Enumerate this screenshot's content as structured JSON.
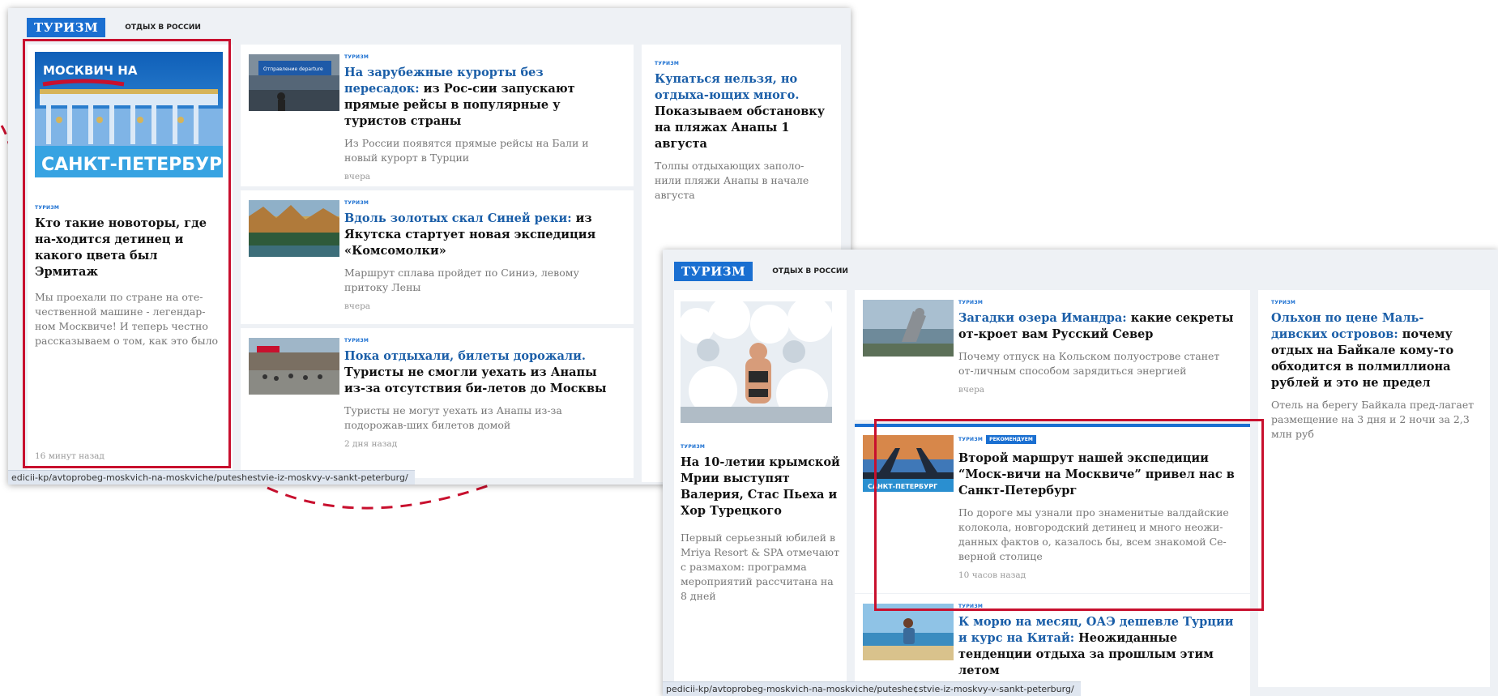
{
  "shot_a": {
    "section_tag": "ТУРИЗМ",
    "sub_tag": "ОТДЫХ В РОССИИ",
    "featured": {
      "banner_top": "МОСКВИЧ НА",
      "banner_bottom": "САНКТ-ПЕТЕРБУРГ",
      "kicker": "ТУРИЗМ",
      "title": "Кто такие новоторы, где на-ходится детинец и какого цвета был Эрмитаж",
      "lead": "Мы проехали по стране на оте-чественной машине - легендар-ном Москвиче! И теперь честно рассказываем о том, как это было",
      "time": "16 минут назад"
    },
    "rows": [
      {
        "kicker": "ТУРИЗМ",
        "title_highlight": "На зарубежные курорты без пересадок:",
        "title_rest": " из Рос-сии запускают прямые рейсы в популярные у туристов страны",
        "lead": "Из России появятся прямые рейсы на Бали и новый курорт в Турции",
        "time": "вчера",
        "sign_text": "Отправление departure"
      },
      {
        "kicker": "ТУРИЗМ",
        "title_highlight": "Вдоль золотых скал Синей реки:",
        "title_rest": " из Якутска стартует новая экспедиция «Комсомолки»",
        "lead": "Маршрут сплава пройдет по Синиэ, левому притоку Лены",
        "time": "вчера"
      },
      {
        "kicker": "ТУРИЗМ",
        "title_highlight": "Пока отдыхали, билеты дорожали.",
        "title_rest": " Туристы не смогли уехать из Анапы из-за отсутствия би-летов до Москвы",
        "lead": "Туристы не могут уехать из Анапы из-за подорожав-ших билетов домой",
        "time": "2 дня назад"
      }
    ],
    "side": {
      "kicker": "ТУРИЗМ",
      "title_highlight": "Купаться нельзя, но отдыха-ющих много.",
      "title_rest": " Показываем обстановку на пляжах Анапы 1 августа",
      "lead": "Толпы отдыхающих заполо-нили пляжи Анапы в начале августа"
    },
    "url": "edicii-kp/avtoprobeg-moskvich-na-moskviche/puteshestvie-iz-moskvy-v-sankt-peterburg/"
  },
  "shot_b": {
    "section_tag": "ТУРИЗМ",
    "sub_tag": "ОТДЫХ В РОССИИ",
    "featured": {
      "kicker": "ТУРИЗМ",
      "title": "На 10-летии крымской Мрии выступят Валерия, Стас Пьеха и Хор Турецкого",
      "lead": "Первый серьезный юбилей в Mriya Resort & SPA отмечают с размахом: программа мероприятий рассчитана на 8 дней"
    },
    "rows": [
      {
        "kicker": "ТУРИЗМ",
        "title_highlight": "Загадки озера Имандра:",
        "title_rest": " какие секреты от-кроет вам Русский Север",
        "lead": "Почему отпуск на Кольском полуострове станет от-личным способом зарядиться энергией",
        "time": "вчера"
      },
      {
        "kicker": "ТУРИЗМ",
        "badge": "РЕКОМЕНДУЕМ",
        "title": "Второй маршрут нашей экспедиции “Моск-вичи на Москвиче” привел нас в Санкт-Петербург",
        "lead": "По дороге мы узнали про знаменитые валдайские колокола, новгородский детинец и много неожи-данных фактов о, казалось бы, всем знакомой Се-верной столице",
        "time": "10 часов назад",
        "thumb_text": "САНКТ-ПЕТЕРБУРГ"
      },
      {
        "kicker": "ТУРИЗМ",
        "title_highlight": "К морю на месяц, ОАЭ дешевле Турции и курс на Китай:",
        "title_rest": " Неожиданные тенденции отдыха за прошлым этим летом"
      }
    ],
    "side": {
      "kicker": "ТУРИЗМ",
      "title_highlight": "Ольхон по цене Маль-дивских островов:",
      "title_rest": " почему отдых на Байкале кому-то обходится в полмиллиона рублей и это не предел",
      "lead": "Отель на берегу Байкала пред-лагает размещение на 3 дня и 2 ночи за 2,3 млн руб"
    },
    "url": "pedicii-kp/avtoprobeg-moskvich-na-moskviche/puteshe¢stvie-iz-moskvy-v-sankt-peterburg/"
  },
  "colors": {
    "accent": "#1a6fd1",
    "highlight_title": "#1a5ea8",
    "annotation_red": "#c8102e"
  }
}
